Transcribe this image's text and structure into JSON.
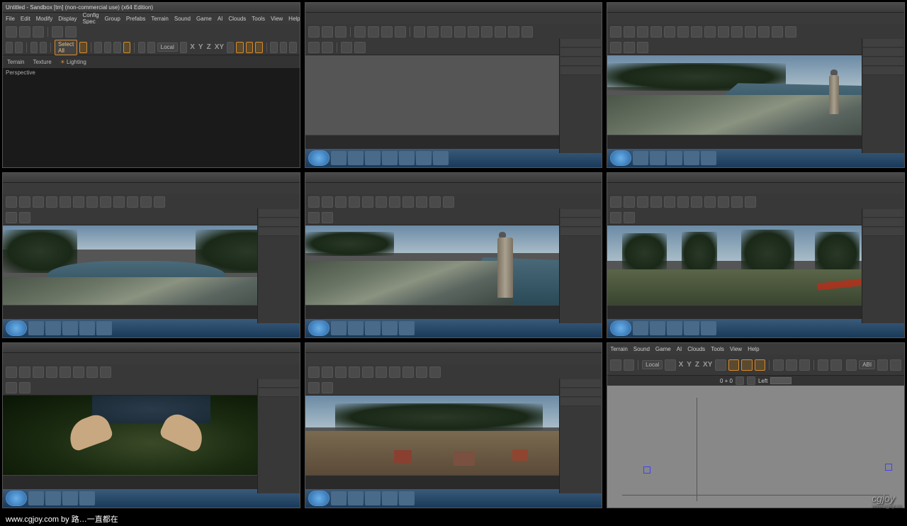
{
  "window_title": "Untitled - Sandbox [tm] (non-commercial use) (x64 Edition)",
  "menu": [
    "File",
    "Edit",
    "Modify",
    "Display",
    "Config Spec",
    "Group",
    "Prefabs",
    "Terrain",
    "Sound",
    "Game",
    "AI",
    "Clouds",
    "Tools",
    "View",
    "Help"
  ],
  "menu_short": [
    "Terrain",
    "Sound",
    "Game",
    "AI",
    "Clouds",
    "Tools",
    "View",
    "Help"
  ],
  "toolbar2": {
    "select_all": "Select All",
    "local": "Local",
    "axes": [
      "X",
      "Y",
      "Z",
      "XY"
    ]
  },
  "modebar": {
    "terrain": "Terrain",
    "texture": "Texture",
    "lighting": "Lighting"
  },
  "viewport_label": "Perspective",
  "timeline": {
    "frame": "0 + 0",
    "view": "Left"
  },
  "watermark": {
    "text": "www.cgjoy.com by 路…一直都在",
    "logo": "cgjoy",
    "sub": "www.cgjoy.co"
  }
}
